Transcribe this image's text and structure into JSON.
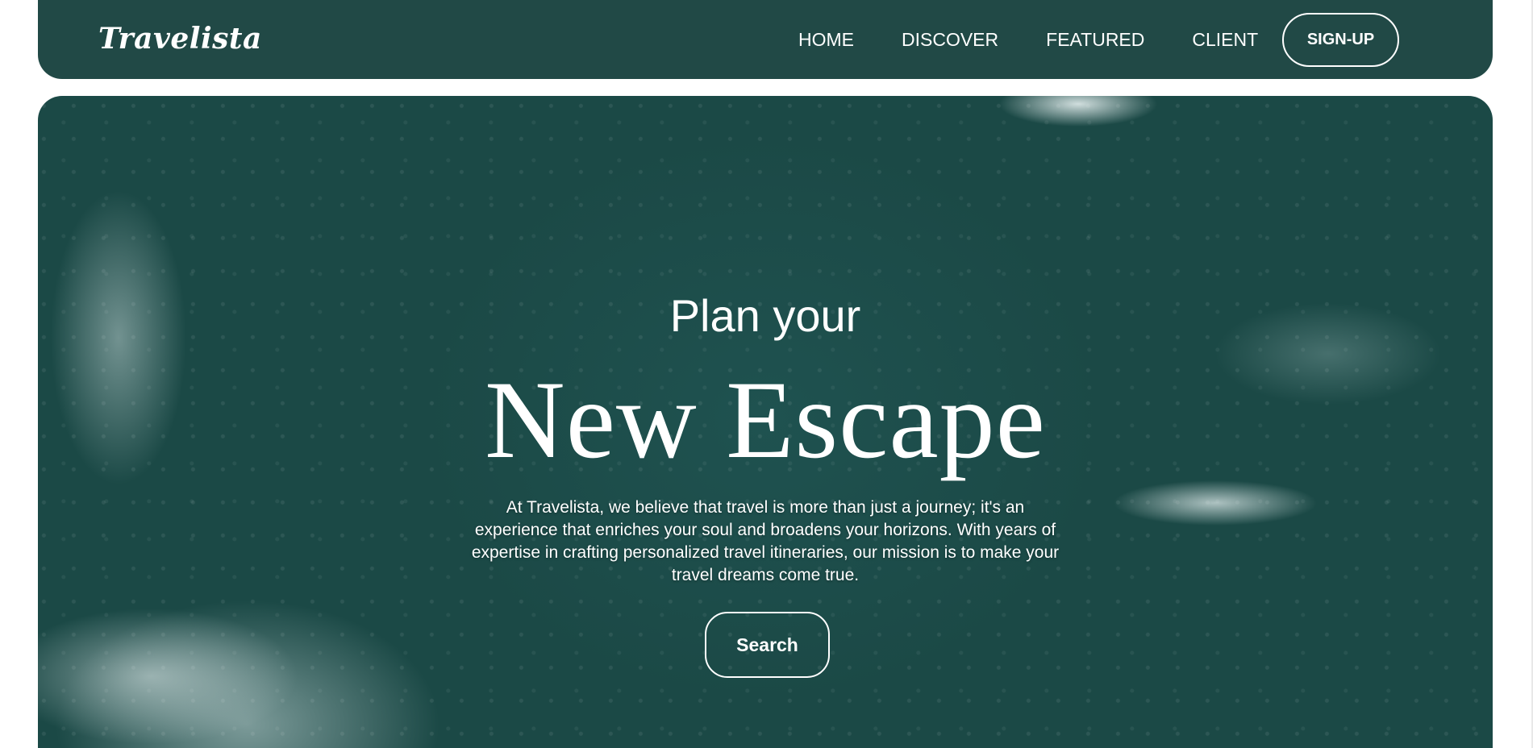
{
  "nav": {
    "logo": "Travelista",
    "links": [
      "HOME",
      "DISCOVER",
      "FEATURED",
      "CLIENT"
    ],
    "signup_label": "SIGN-UP"
  },
  "hero": {
    "subtitle": "Plan your",
    "title": "New Escape",
    "description": "At Travelista, we believe that travel is more than just a journey; it's an experience that enriches your soul and broadens your horizons. With years of expertise in crafting personalized travel itineraries, our mission is to make your travel dreams come true.",
    "search_label": "Search",
    "background": "aerial-ocean-waves-image"
  },
  "colors": {
    "brand": "#214946",
    "text": "#ffffff"
  }
}
